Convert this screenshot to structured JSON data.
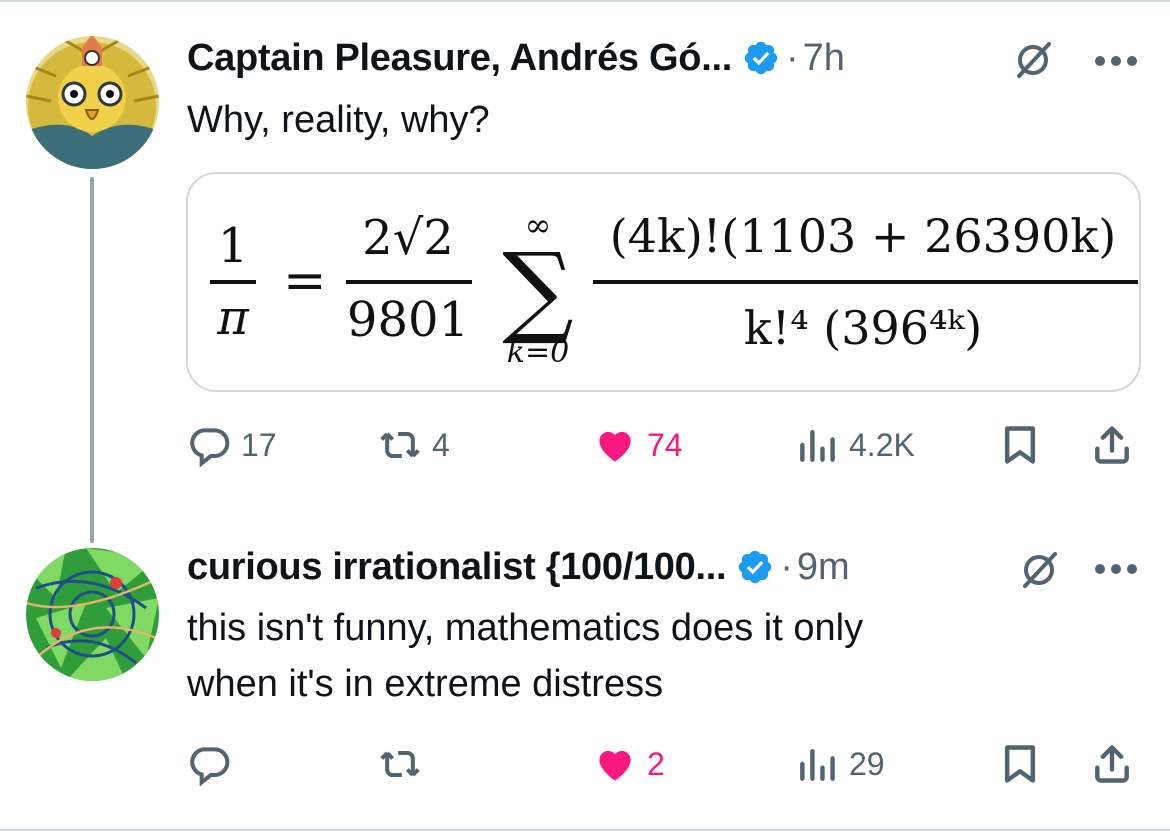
{
  "colors": {
    "text": "#0f1419",
    "muted": "#536471",
    "border": "#cfd9de",
    "verified": "#1d9bf0",
    "like": "#f91880"
  },
  "tweets": [
    {
      "author": "Captain Pleasure, Andrés Gó...",
      "separator": "·",
      "time": "7h",
      "text": "Why, reality, why?",
      "formula": {
        "lhs_num": "1",
        "lhs_den": "π",
        "eq": "=",
        "coef_num": "2√2",
        "coef_den": "9801",
        "sum_upper": "∞",
        "sum_lower": "k=0",
        "term_num": "(4k)!(1103 + 26390k)",
        "term_den": "k!⁴ (396⁴ᵏ)"
      },
      "actions": {
        "replies": "17",
        "retweets": "4",
        "likes": "74",
        "views": "4.2K"
      },
      "icons": [
        "verified-badge-icon",
        "grok-icon",
        "more-icon",
        "reply-icon",
        "retweet-icon",
        "heart-icon",
        "views-icon",
        "bookmark-icon",
        "share-icon"
      ]
    },
    {
      "author": "curious irrationalist {100/100...",
      "separator": "·",
      "time": "9m",
      "text_line1": "this isn't funny, mathematics does it only",
      "text_line2": "when it's in extreme distress",
      "actions": {
        "replies": "",
        "retweets": "",
        "likes": "2",
        "views": "29"
      }
    }
  ]
}
